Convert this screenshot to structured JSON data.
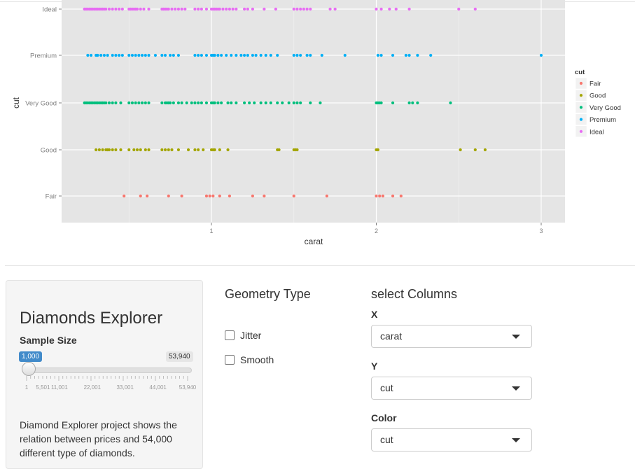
{
  "chart_data": {
    "type": "scatter",
    "xlabel": "carat",
    "ylabel": "cut",
    "xlim": [
      0.0,
      3.15
    ],
    "x_ticks": [
      "1",
      "2",
      "3"
    ],
    "categories": [
      "Fair",
      "Good",
      "Very Good",
      "Premium",
      "Ideal"
    ],
    "grid": true,
    "legend": {
      "title": "cut",
      "placement": "right"
    },
    "series": [
      {
        "name": "Fair",
        "color": "#F8766D",
        "x": [
          0.47,
          0.57,
          0.61,
          0.74,
          0.82,
          0.97,
          0.99,
          1.01,
          1.05,
          1.11,
          1.25,
          1.32,
          1.5,
          1.7,
          2.0,
          2.02,
          2.04,
          2.1,
          2.15
        ]
      },
      {
        "name": "Good",
        "color": "#A3A500",
        "x": [
          0.3,
          0.32,
          0.34,
          0.36,
          0.37,
          0.38,
          0.4,
          0.42,
          0.45,
          0.5,
          0.53,
          0.55,
          0.57,
          0.6,
          0.62,
          0.7,
          0.72,
          0.74,
          0.76,
          0.8,
          0.86,
          0.9,
          0.92,
          0.95,
          1.0,
          1.01,
          1.02,
          1.05,
          1.1,
          1.4,
          1.41,
          1.5,
          1.51,
          1.52,
          2.0,
          2.01,
          2.51,
          2.6,
          2.66
        ]
      },
      {
        "name": "Very Good",
        "color": "#00BF7D",
        "x": [
          0.23,
          0.24,
          0.25,
          0.26,
          0.27,
          0.28,
          0.29,
          0.3,
          0.31,
          0.32,
          0.33,
          0.34,
          0.35,
          0.36,
          0.38,
          0.4,
          0.42,
          0.45,
          0.5,
          0.52,
          0.54,
          0.56,
          0.58,
          0.6,
          0.62,
          0.7,
          0.72,
          0.73,
          0.74,
          0.75,
          0.77,
          0.8,
          0.82,
          0.85,
          0.88,
          0.9,
          0.92,
          0.94,
          0.97,
          1.0,
          1.01,
          1.02,
          1.04,
          1.06,
          1.1,
          1.12,
          1.15,
          1.2,
          1.23,
          1.26,
          1.3,
          1.33,
          1.36,
          1.4,
          1.43,
          1.47,
          1.5,
          1.52,
          1.54,
          1.6,
          1.66,
          2.0,
          2.01,
          2.02,
          2.03,
          2.1,
          2.2,
          2.22,
          2.25,
          2.45
        ]
      },
      {
        "name": "Premium",
        "color": "#00B0F6",
        "x": [
          0.25,
          0.27,
          0.3,
          0.31,
          0.33,
          0.35,
          0.37,
          0.4,
          0.42,
          0.44,
          0.46,
          0.5,
          0.52,
          0.54,
          0.56,
          0.58,
          0.6,
          0.62,
          0.66,
          0.7,
          0.72,
          0.75,
          0.77,
          0.8,
          0.9,
          0.92,
          0.94,
          0.97,
          1.0,
          1.01,
          1.02,
          1.04,
          1.06,
          1.09,
          1.12,
          1.15,
          1.18,
          1.2,
          1.22,
          1.25,
          1.27,
          1.3,
          1.33,
          1.36,
          1.4,
          1.5,
          1.52,
          1.54,
          1.58,
          1.6,
          1.67,
          1.81,
          2.01,
          2.03,
          2.1,
          2.18,
          2.2,
          2.25,
          2.33,
          3.0
        ]
      },
      {
        "name": "Ideal",
        "color": "#E76BF3",
        "x": [
          0.23,
          0.24,
          0.25,
          0.26,
          0.27,
          0.28,
          0.29,
          0.3,
          0.31,
          0.32,
          0.33,
          0.34,
          0.35,
          0.36,
          0.38,
          0.4,
          0.42,
          0.44,
          0.46,
          0.5,
          0.51,
          0.52,
          0.53,
          0.54,
          0.55,
          0.57,
          0.59,
          0.62,
          0.7,
          0.71,
          0.72,
          0.73,
          0.74,
          0.76,
          0.78,
          0.8,
          0.82,
          0.84,
          0.9,
          0.92,
          0.94,
          0.97,
          1.0,
          1.01,
          1.02,
          1.03,
          1.04,
          1.05,
          1.07,
          1.09,
          1.11,
          1.13,
          1.15,
          1.2,
          1.22,
          1.25,
          1.32,
          1.39,
          1.5,
          1.52,
          1.54,
          1.56,
          1.58,
          1.6,
          1.72,
          1.75,
          2.0,
          2.03,
          2.08,
          2.12,
          2.2,
          2.5,
          2.6
        ]
      }
    ]
  },
  "sidebar": {
    "title": "Diamonds Explorer",
    "sample_size_label": "Sample Size",
    "slider": {
      "min": 1,
      "max": 53940,
      "value": 1000,
      "value_label": "1,000",
      "max_label": "53,940",
      "ticks": [
        "1",
        "5,501",
        "11,001",
        "22,001",
        "33,001",
        "44,001",
        "53,940"
      ]
    },
    "description": "Diamond Explorer project shows the relation between prices and 54,000 different type of diamonds."
  },
  "geometry": {
    "title": "Geometry Type",
    "jitter_label": "Jitter",
    "jitter_checked": false,
    "smooth_label": "Smooth",
    "smooth_checked": false
  },
  "columns": {
    "title": "select Columns",
    "x_label": "X",
    "x_value": "carat",
    "y_label": "Y",
    "y_value": "cut",
    "color_label": "Color",
    "color_value": "cut"
  }
}
